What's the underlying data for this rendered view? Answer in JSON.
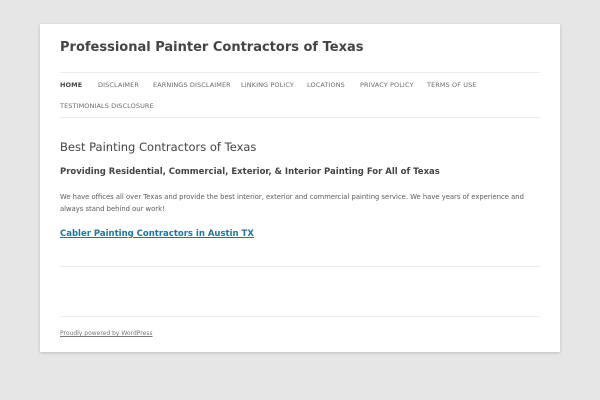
{
  "site": {
    "title": "Professional Painter Contractors of Texas"
  },
  "nav": {
    "items": [
      {
        "label": "HOME",
        "active": true
      },
      {
        "label": "DISCLAIMER",
        "active": false
      },
      {
        "label": "EARNINGS DISCLAIMER",
        "active": false
      },
      {
        "label": "LINKING POLICY",
        "active": false
      },
      {
        "label": "LOCATIONS",
        "active": false
      },
      {
        "label": "PRIVACY POLICY",
        "active": false
      },
      {
        "label": "TERMS OF USE",
        "active": false
      },
      {
        "label": "TESTIMONIALS DISCLOSURE",
        "active": false
      }
    ]
  },
  "entry": {
    "title": "Best Painting Contractors of Texas",
    "subtitle": "Providing Residential, Commercial, Exterior, & Interior Painting For All of Texas",
    "body": "We have offices all over Texas and provide the best interior, exterior and commercial painting service. We have years of experience and always stand behind our work!",
    "link_text": "Cabler Painting Contractors in Austin TX"
  },
  "footer": {
    "credit": "Proudly powered by WordPress"
  },
  "colors": {
    "background": "#e6e6e6",
    "page": "#ffffff",
    "text": "#444444",
    "link": "#21759b"
  }
}
